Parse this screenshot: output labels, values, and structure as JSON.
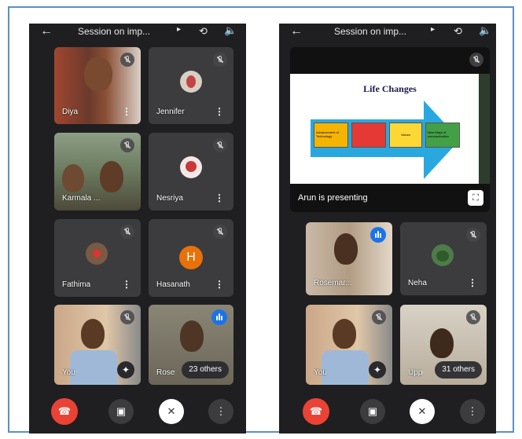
{
  "left": {
    "meeting_title": "Session on imp...",
    "participants": [
      {
        "name": "Diya"
      },
      {
        "name": "Jennifer"
      },
      {
        "name": "Karmala ..."
      },
      {
        "name": "Nesriya"
      },
      {
        "name": "Fathima"
      },
      {
        "name": "Hasanath",
        "initial": "H"
      },
      {
        "name": "You"
      },
      {
        "name": "Rose"
      }
    ],
    "others_label": "23 others"
  },
  "right": {
    "meeting_title": "Session on imp...",
    "presentation": {
      "slide_title": "Life Changes",
      "box1": "Advancement of Technology",
      "box3": "Values",
      "box4": "New Ways of communication",
      "caption": "Arun is presenting"
    },
    "participants": [
      {
        "name": "Rosemar..."
      },
      {
        "name": "Neha"
      },
      {
        "name": "You"
      },
      {
        "name": "Upp"
      }
    ],
    "others_label": "31 others"
  },
  "colors": {
    "end_call": "#ea4335",
    "speaking": "#1a73e8",
    "avatar_orange": "#e8710a",
    "border": "#5b8fc9"
  },
  "icons": [
    "back-arrow-icon",
    "switch-camera-icon",
    "speaker-icon",
    "mic-off-icon",
    "more-icon",
    "end-call-icon",
    "camera-icon",
    "fullscreen-icon",
    "effects-icon",
    "speaking-icon"
  ]
}
